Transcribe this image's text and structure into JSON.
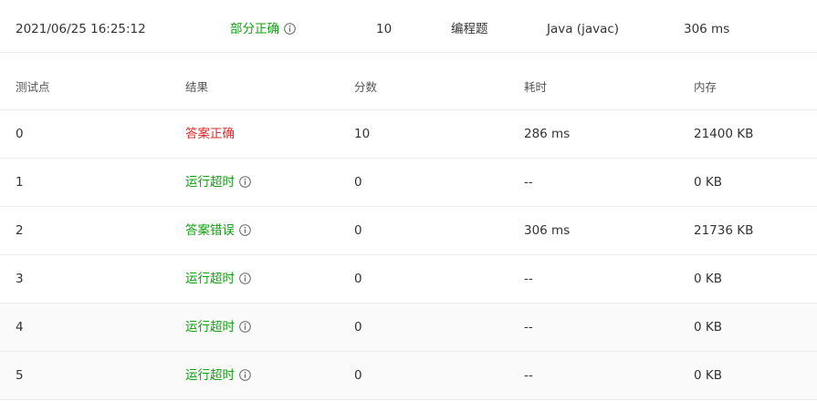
{
  "summary": {
    "submit_time": "2021/06/25 16:25:12",
    "status": "部分正确",
    "score": "10",
    "problem_type": "编程题",
    "language": "Java (javac)",
    "runtime": "306 ms"
  },
  "table": {
    "headers": [
      "测试点",
      "结果",
      "分数",
      "耗时",
      "内存"
    ],
    "rows": [
      {
        "id": "0",
        "result": "答案正确",
        "score": "10",
        "time": "286 ms",
        "memory": "21400 KB"
      },
      {
        "id": "1",
        "result": "运行超时",
        "score": "0",
        "time": "--",
        "memory": "0 KB"
      },
      {
        "id": "2",
        "result": "答案错误",
        "score": "0",
        "time": "306 ms",
        "memory": "21736 KB"
      },
      {
        "id": "3",
        "result": "运行超时",
        "score": "0",
        "time": "--",
        "memory": "0 KB"
      },
      {
        "id": "4",
        "result": "运行超时",
        "score": "0",
        "time": "--",
        "memory": "0 KB"
      },
      {
        "id": "5",
        "result": "运行超时",
        "score": "0",
        "time": "--",
        "memory": "0 KB"
      }
    ]
  },
  "colors": {
    "accepted": "#e02828",
    "other_status": "#12a012",
    "text": "#333333",
    "border": "#ececec",
    "alt_row_bg": "#fafafa"
  },
  "icons": {
    "status_info": "info-icon"
  }
}
